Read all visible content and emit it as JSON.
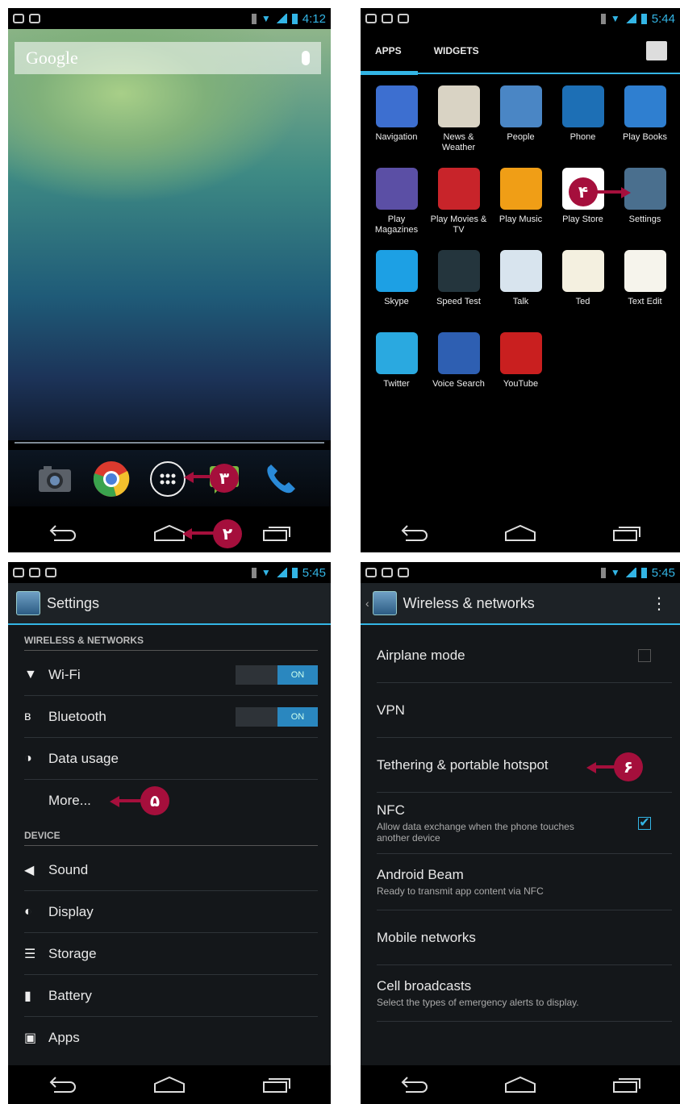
{
  "panel1": {
    "time": "4:12",
    "search_label": "Google",
    "callout_3": "۳",
    "callout_2": "۲"
  },
  "panel2": {
    "time": "5:44",
    "tabs": [
      "APPS",
      "WIDGETS"
    ],
    "callout_4": "۴",
    "apps": [
      {
        "label": "Navigation",
        "icon": "navigation-icon",
        "color": "#3d6fd0"
      },
      {
        "label": "News & Weather",
        "icon": "news-weather-icon",
        "color": "#d9d3c4"
      },
      {
        "label": "People",
        "icon": "people-icon",
        "color": "#4a86c5"
      },
      {
        "label": "Phone",
        "icon": "phone-icon",
        "color": "#1d6fb5"
      },
      {
        "label": "Play Books",
        "icon": "play-books-icon",
        "color": "#2f7fd0"
      },
      {
        "label": "Play Magazines",
        "icon": "play-magazines-icon",
        "color": "#5b4fa5"
      },
      {
        "label": "Play Movies & TV",
        "icon": "play-movies-icon",
        "color": "#c8242a"
      },
      {
        "label": "Play Music",
        "icon": "play-music-icon",
        "color": "#f09e16"
      },
      {
        "label": "Play Store",
        "icon": "play-store-icon",
        "color": "#ffffff"
      },
      {
        "label": "Settings",
        "icon": "settings-icon",
        "color": "#4a6f8e"
      },
      {
        "label": "Skype",
        "icon": "skype-icon",
        "color": "#1da0e4"
      },
      {
        "label": "Speed Test",
        "icon": "speed-test-icon",
        "color": "#24353d"
      },
      {
        "label": "Talk",
        "icon": "talk-icon",
        "color": "#d8e4ee"
      },
      {
        "label": "Ted",
        "icon": "ted-icon",
        "color": "#f4f0e0"
      },
      {
        "label": "Text Edit",
        "icon": "text-edit-icon",
        "color": "#f6f4ec"
      },
      {
        "label": "Twitter",
        "icon": "twitter-icon",
        "color": "#2aa9e0"
      },
      {
        "label": "Voice Search",
        "icon": "voice-search-icon",
        "color": "#2e5fb2"
      },
      {
        "label": "YouTube",
        "icon": "youtube-icon",
        "color": "#c91f1f"
      }
    ]
  },
  "panel3": {
    "time": "5:45",
    "title": "Settings",
    "section_wireless": "WIRELESS & NETWORKS",
    "section_device": "DEVICE",
    "wifi": "Wi-Fi",
    "bluetooth": "Bluetooth",
    "toggle_on": "ON",
    "data_usage": "Data usage",
    "more": "More...",
    "callout_5": "۵",
    "sound": "Sound",
    "display": "Display",
    "storage": "Storage",
    "battery": "Battery",
    "apps": "Apps"
  },
  "panel4": {
    "time": "5:45",
    "title": "Wireless & networks",
    "airplane": "Airplane mode",
    "vpn": "VPN",
    "tethering": "Tethering & portable hotspot",
    "callout_6": "۶",
    "nfc": "NFC",
    "nfc_sub": "Allow data exchange when the phone touches another device",
    "beam": "Android Beam",
    "beam_sub": "Ready to transmit app content via NFC",
    "mobile": "Mobile networks",
    "cell": "Cell broadcasts",
    "cell_sub": "Select the types of emergency alerts to display."
  }
}
